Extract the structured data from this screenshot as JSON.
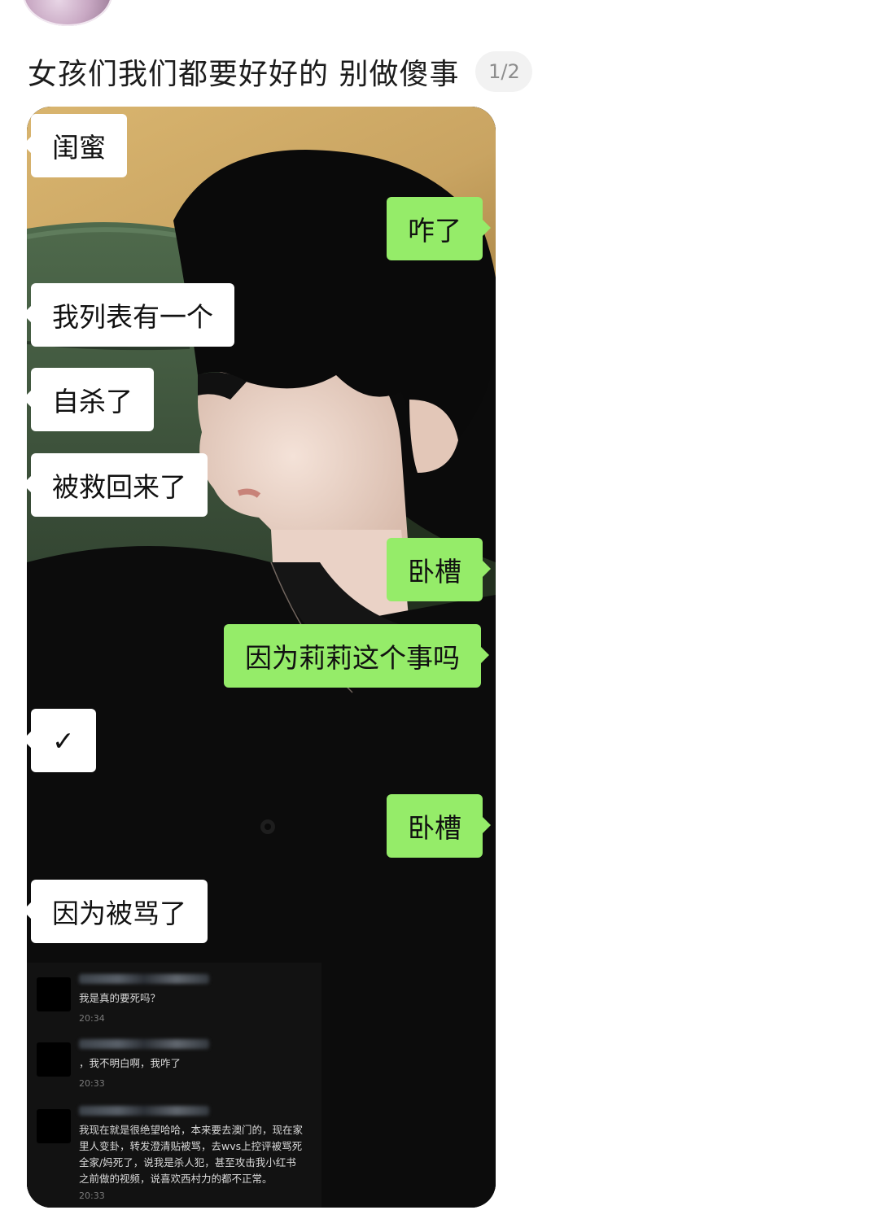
{
  "post": {
    "title": "女孩们我们都要好好的 别做傻事",
    "page_indicator": "1/2"
  },
  "chat": {
    "messages": [
      {
        "side": "left",
        "text": "闺蜜"
      },
      {
        "side": "right",
        "text": "咋了"
      },
      {
        "side": "left",
        "text": "我列表有一个"
      },
      {
        "side": "left",
        "text": "自杀了"
      },
      {
        "side": "left",
        "text": "被救回来了"
      },
      {
        "side": "right",
        "text": "卧槽"
      },
      {
        "side": "right",
        "text": "因为莉莉这个事吗"
      },
      {
        "side": "left",
        "text": "✓"
      },
      {
        "side": "right",
        "text": "卧槽"
      },
      {
        "side": "left",
        "text": "因为被骂了"
      }
    ]
  },
  "comments": [
    {
      "text": "我是真的要死吗？",
      "time": "20:34"
    },
    {
      "text": "，我不明白啊，我咋了",
      "time": "20:33"
    },
    {
      "text": "我现在就是很绝望哈哈，本来要去澳门的，现在家\n里人变卦，转发澄清贴被骂，去wvs上控评被骂死\n全家/妈死了，说我是杀人犯，甚至攻击我小红书\n之前做的视频，说喜欢西村力的都不正常。",
      "time": "20:33"
    }
  ],
  "colors": {
    "bubble_left": "#ffffff",
    "bubble_right": "#95ec69",
    "page_indicator_bg": "#f2f2f2"
  }
}
